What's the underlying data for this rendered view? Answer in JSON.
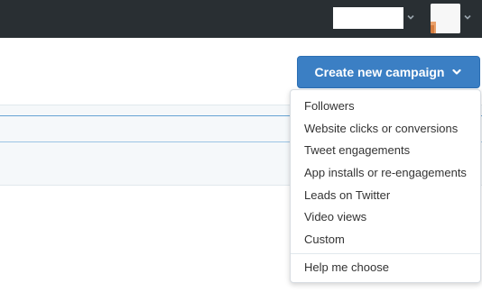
{
  "header": {
    "account_chevron_icon": "chevron-down-icon",
    "avatar_chevron_icon": "chevron-down-icon",
    "colors": {
      "bar": "#292f33",
      "chevron": "#9aa5ad"
    }
  },
  "toolbar": {
    "create_button_label": "Create new campaign",
    "create_button_icon": "chevron-down-icon",
    "create_button_color": "#3b7fc4"
  },
  "dropdown": {
    "items": [
      {
        "label": "Followers"
      },
      {
        "label": "Website clicks or conversions"
      },
      {
        "label": "Tweet engagements"
      },
      {
        "label": "App installs or re-engagements"
      },
      {
        "label": "Leads on Twitter"
      },
      {
        "label": "Video views"
      },
      {
        "label": "Custom"
      }
    ],
    "help_label": "Help me choose"
  }
}
